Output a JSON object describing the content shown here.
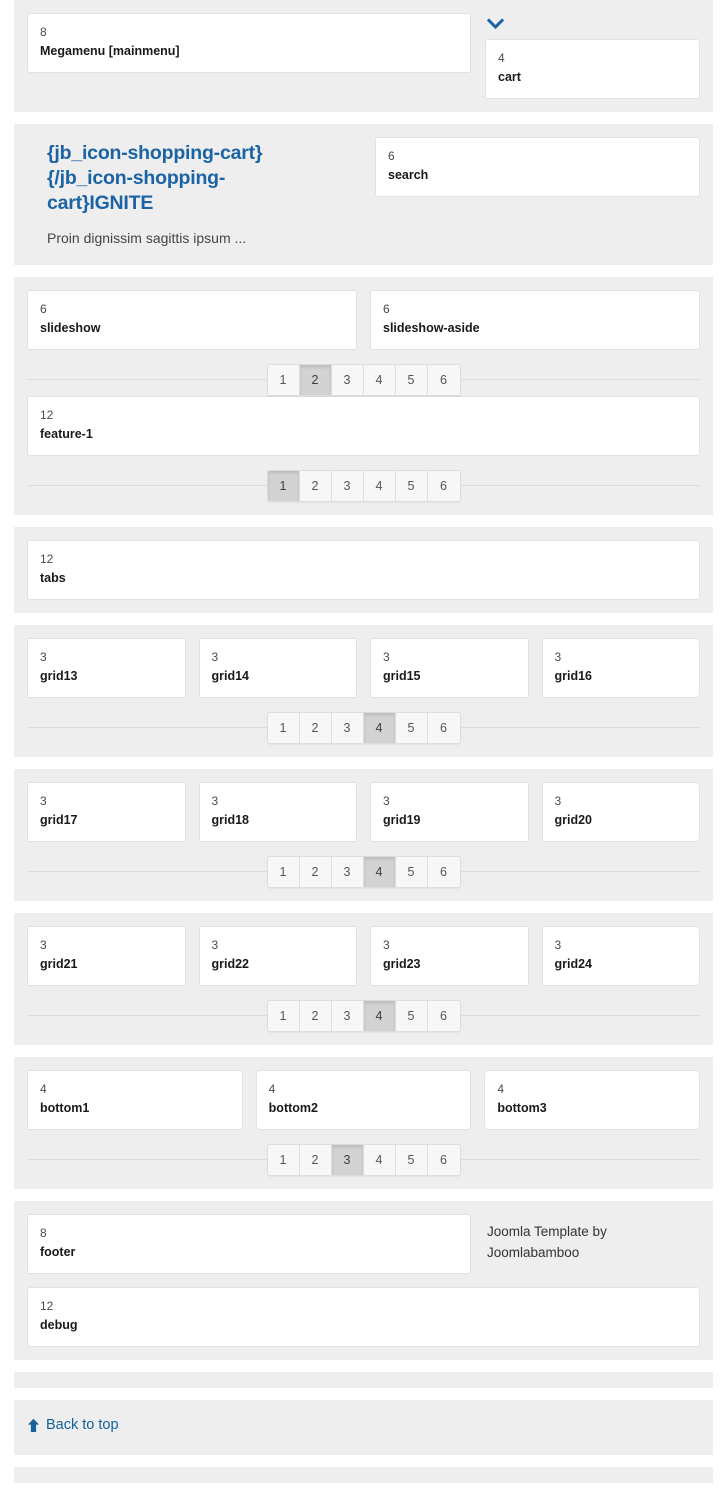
{
  "colors": {
    "accent": "#1b63a5",
    "link": "#15619c",
    "band_bg": "#eeeeee",
    "box_bg": "#ffffff",
    "box_border": "#e2e2e2",
    "pager_active": "#d3d3d3"
  },
  "header": {
    "megamenu": {
      "span": "8",
      "position": "Megamenu [mainmenu]"
    },
    "chevron_icon": "chevron-down-icon",
    "cart": {
      "span": "4",
      "position": "cart"
    }
  },
  "brand": {
    "title": "{jb_icon-shopping-cart}{/jb_icon-shopping-cart}IGNITE",
    "tagline": "Proin dignissim sagittis ipsum ...",
    "search": {
      "span": "6",
      "position": "search"
    }
  },
  "slideshow_section": {
    "boxes": [
      {
        "span": "6",
        "position": "slideshow"
      },
      {
        "span": "6",
        "position": "slideshow-aside"
      }
    ],
    "pager": {
      "pages": [
        "1",
        "2",
        "3",
        "4",
        "5",
        "6"
      ],
      "active": "2"
    },
    "feature": {
      "span": "12",
      "position": "feature-1"
    },
    "feature_pager": {
      "pages": [
        "1",
        "2",
        "3",
        "4",
        "5",
        "6"
      ],
      "active": "1"
    }
  },
  "tabs_section": {
    "box": {
      "span": "12",
      "position": "tabs"
    }
  },
  "grid_sections": [
    {
      "boxes": [
        {
          "span": "3",
          "position": "grid13"
        },
        {
          "span": "3",
          "position": "grid14"
        },
        {
          "span": "3",
          "position": "grid15"
        },
        {
          "span": "3",
          "position": "grid16"
        }
      ],
      "pager": {
        "pages": [
          "1",
          "2",
          "3",
          "4",
          "5",
          "6"
        ],
        "active": "4"
      }
    },
    {
      "boxes": [
        {
          "span": "3",
          "position": "grid17"
        },
        {
          "span": "3",
          "position": "grid18"
        },
        {
          "span": "3",
          "position": "grid19"
        },
        {
          "span": "3",
          "position": "grid20"
        }
      ],
      "pager": {
        "pages": [
          "1",
          "2",
          "3",
          "4",
          "5",
          "6"
        ],
        "active": "4"
      }
    },
    {
      "boxes": [
        {
          "span": "3",
          "position": "grid21"
        },
        {
          "span": "3",
          "position": "grid22"
        },
        {
          "span": "3",
          "position": "grid23"
        },
        {
          "span": "3",
          "position": "grid24"
        }
      ],
      "pager": {
        "pages": [
          "1",
          "2",
          "3",
          "4",
          "5",
          "6"
        ],
        "active": "4"
      }
    }
  ],
  "bottom_section": {
    "boxes": [
      {
        "span": "4",
        "position": "bottom1"
      },
      {
        "span": "4",
        "position": "bottom2"
      },
      {
        "span": "4",
        "position": "bottom3"
      }
    ],
    "pager": {
      "pages": [
        "1",
        "2",
        "3",
        "4",
        "5",
        "6"
      ],
      "active": "3"
    }
  },
  "footer_section": {
    "footer": {
      "span": "8",
      "position": "footer"
    },
    "credit": "Joomla Template by Joomlabamboo",
    "debug": {
      "span": "12",
      "position": "debug"
    }
  },
  "back_to_top": {
    "icon": "arrow-up-icon",
    "label": "Back to top"
  }
}
